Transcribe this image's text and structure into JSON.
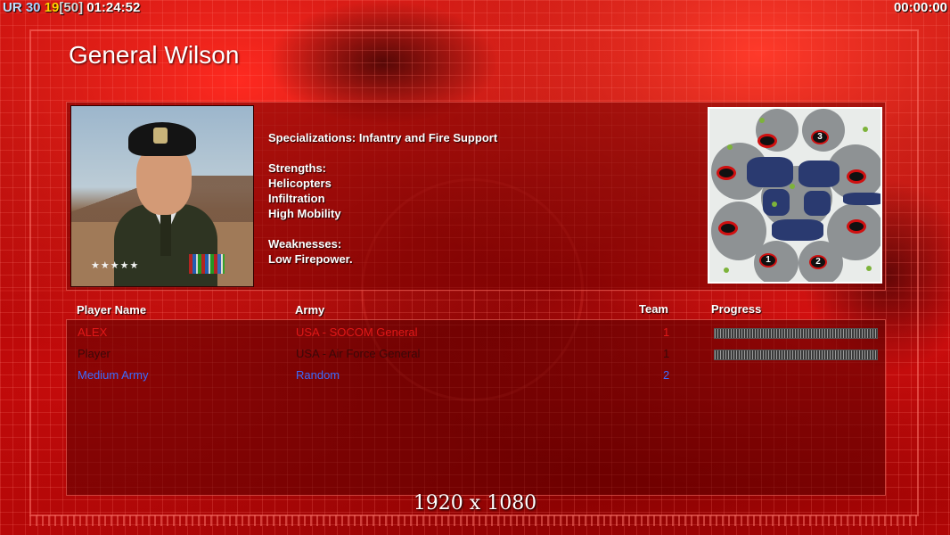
{
  "hud": {
    "prefix": "UR",
    "value_a": "30",
    "value_b": "19",
    "value_c": "[50]",
    "time_left": "01:24:52",
    "time_right": "00:00:00"
  },
  "general": {
    "name": "General Wilson",
    "portrait_icon": "general-portrait",
    "description_lines": [
      "Specializations: Infantry and Fire Support",
      "",
      "Strengths:",
      "Helicopters",
      "Infiltration",
      "High Mobility",
      "",
      "Weaknesses:",
      "Low Firepower."
    ]
  },
  "minimap": {
    "labels": [
      "3",
      "1",
      "2"
    ]
  },
  "columns": {
    "player": "Player Name",
    "army": "Army",
    "team": "Team",
    "progress": "Progress"
  },
  "players": [
    {
      "name": "ALEX",
      "army": "USA - SOCOM General",
      "team": "1",
      "color": "#e01818",
      "progress": 1.0
    },
    {
      "name": "Player",
      "army": "USA - Air Force General",
      "team": "1",
      "color": "#3a0808",
      "progress": 1.0
    },
    {
      "name": "Medium Army",
      "army": "Random",
      "team": "2",
      "color": "#3a6cff",
      "progress": null
    }
  ],
  "resolution": "1920 x 1080",
  "colors": {
    "accent_red": "#d01010",
    "text_white": "#ffffff",
    "hud_yellow": "#ffd500"
  }
}
